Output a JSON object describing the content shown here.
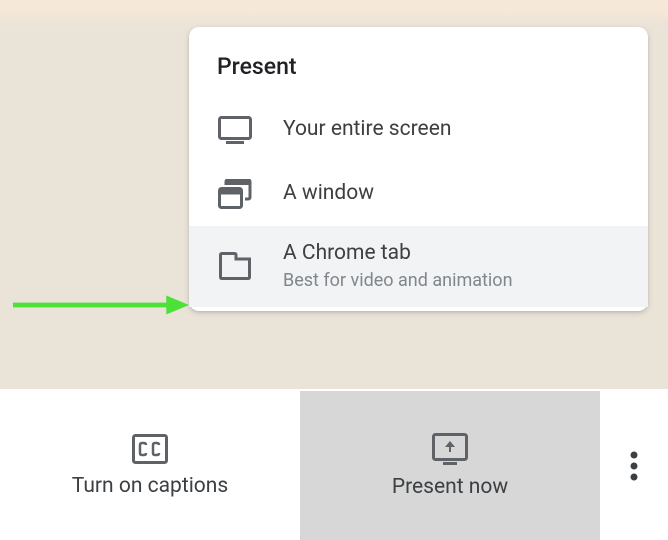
{
  "menu": {
    "title": "Present",
    "items": [
      {
        "label": "Your entire screen",
        "sublabel": null,
        "highlighted": false
      },
      {
        "label": "A window",
        "sublabel": null,
        "highlighted": false
      },
      {
        "label": "A Chrome tab",
        "sublabel": "Best for video and animation",
        "highlighted": true
      }
    ]
  },
  "toolbar": {
    "captions_label": "Turn on captions",
    "present_label": "Present now"
  },
  "colors": {
    "icon": "#5f6368",
    "arrow": "#4de038"
  }
}
